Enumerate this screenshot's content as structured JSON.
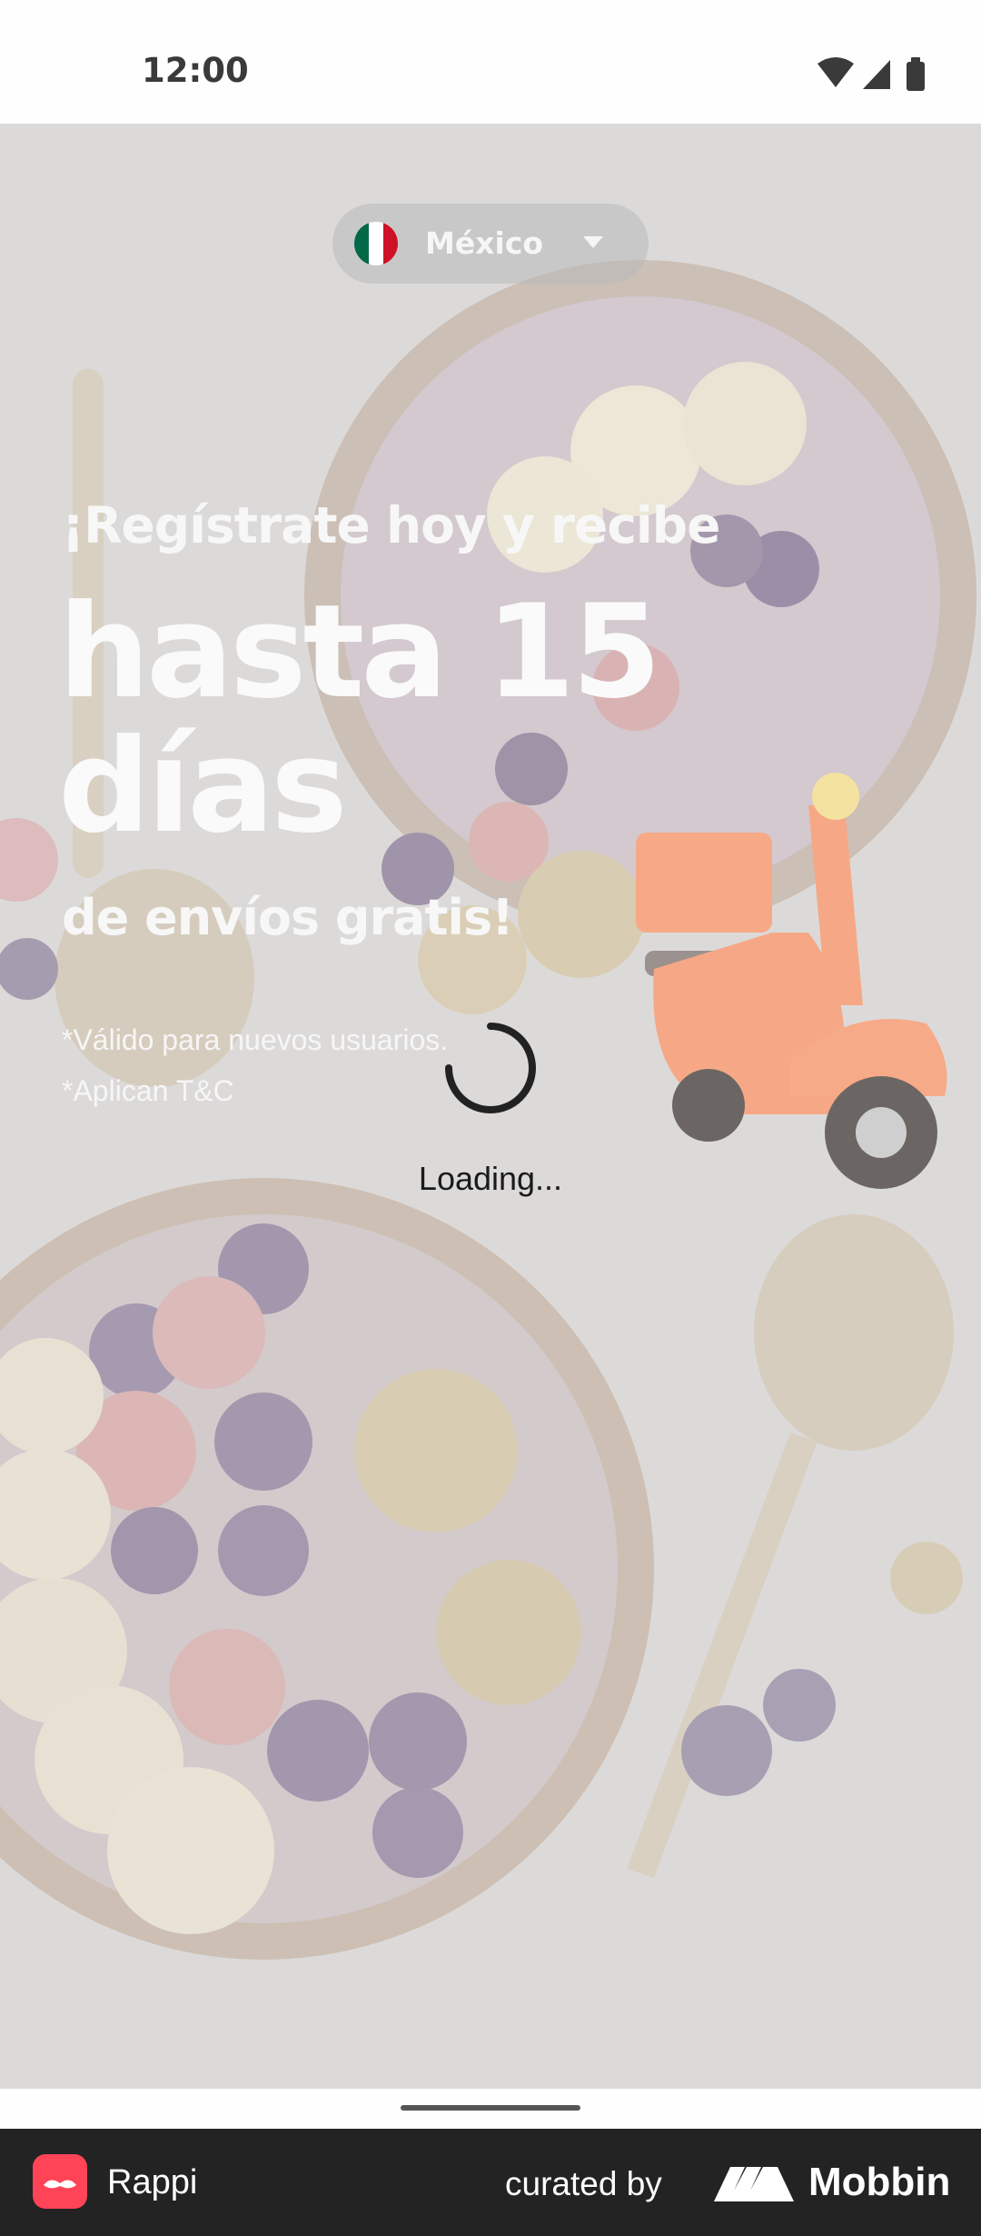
{
  "status_bar": {
    "time": "12:00"
  },
  "country_selector": {
    "country": "México",
    "flag_colors": [
      "#006847",
      "#ffffff",
      "#ce1126"
    ]
  },
  "promo": {
    "line1": "¡Regístrate hoy y recibe",
    "line2": "hasta 15 días",
    "line3": "de envíos gratis!",
    "note1": "*Válido para nuevos usuarios.",
    "note2": "*Aplican T&C"
  },
  "loading": {
    "text": "Loading..."
  },
  "footer": {
    "app_name": "Rappi",
    "curated_label": "curated by",
    "brand": "Mobbin",
    "app_icon_color": "#ff4458"
  },
  "icons": [
    "wifi-icon",
    "signal-icon",
    "battery-icon",
    "chevron-down-icon",
    "spinner-icon",
    "scooter-illustration"
  ]
}
